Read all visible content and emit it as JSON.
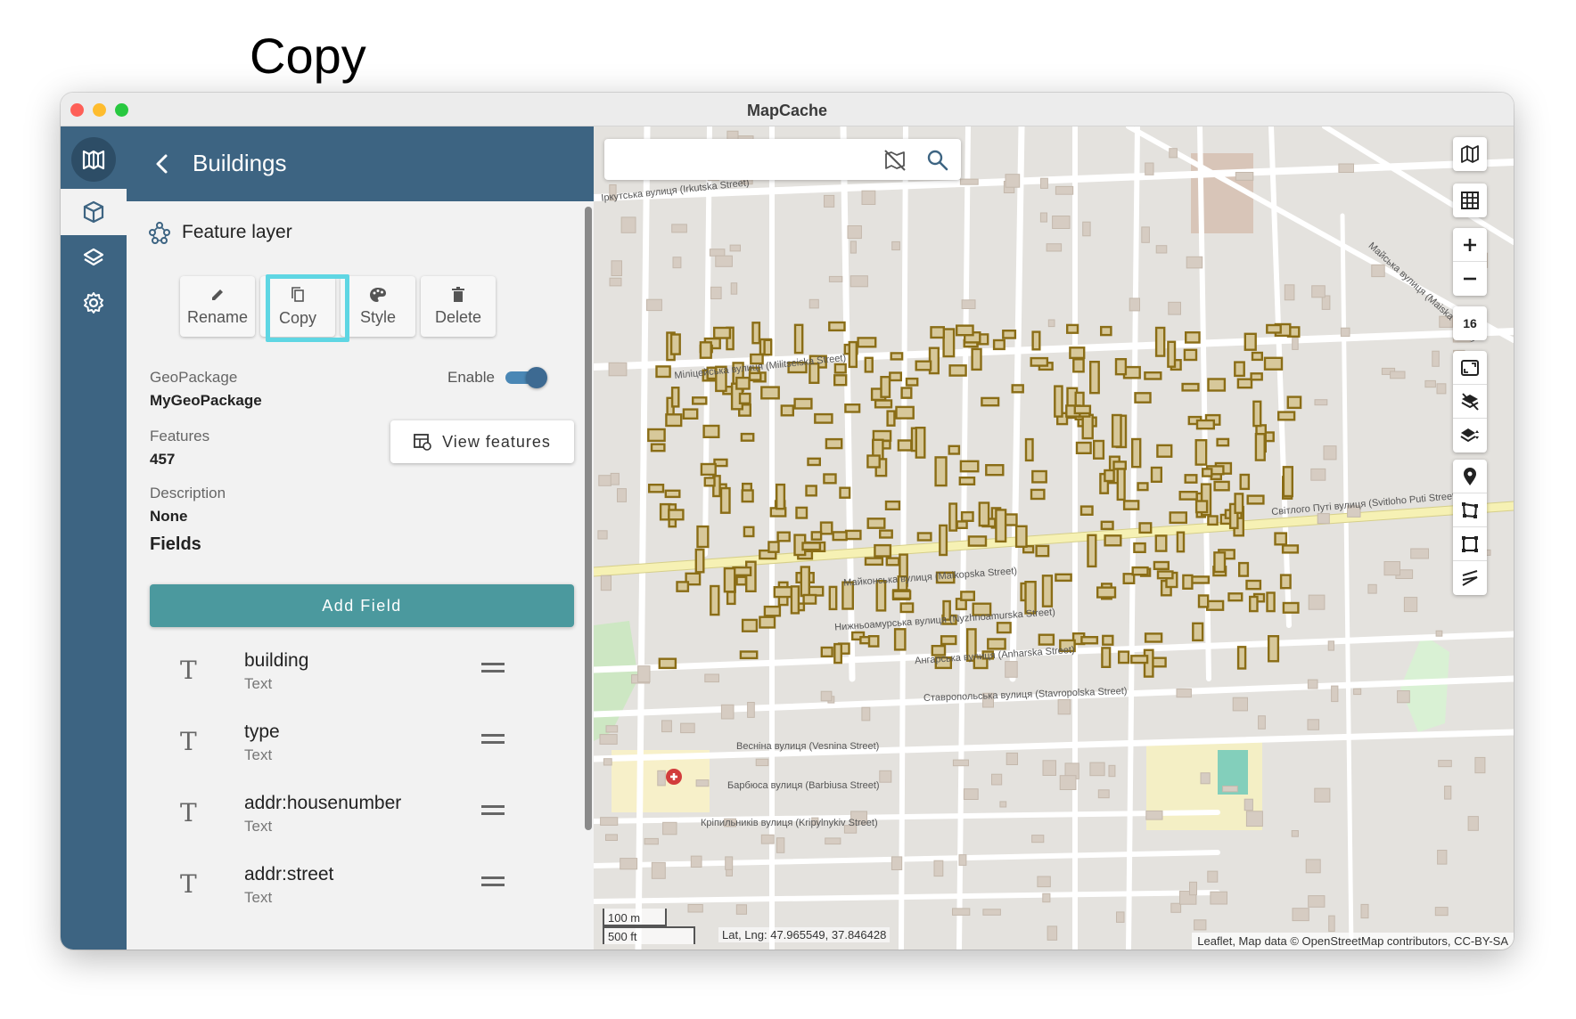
{
  "annotation": {
    "label": "Copy"
  },
  "window": {
    "title": "MapCache"
  },
  "header": {
    "title": "Buildings"
  },
  "layer": {
    "type_label": "Feature layer"
  },
  "actions": [
    {
      "label": "Rename",
      "icon": "pencil-icon"
    },
    {
      "label": "Copy",
      "icon": "copy-icon"
    },
    {
      "label": "Style",
      "icon": "palette-icon"
    },
    {
      "label": "Delete",
      "icon": "trash-icon"
    }
  ],
  "details": {
    "geopackage_label": "GeoPackage",
    "geopackage_value": "MyGeoPackage",
    "enable_label": "Enable",
    "enabled": true,
    "features_label": "Features",
    "features_value": "457",
    "description_label": "Description",
    "description_value": "None",
    "view_features_label": "View features"
  },
  "fields": {
    "title": "Fields",
    "add_label": "Add Field",
    "items": [
      {
        "name": "building",
        "type": "Text"
      },
      {
        "name": "type",
        "type": "Text"
      },
      {
        "name": "addr:housenumber",
        "type": "Text"
      },
      {
        "name": "addr:street",
        "type": "Text"
      }
    ]
  },
  "map": {
    "search_placeholder": "",
    "zoom_level": "16",
    "scale_metric": "100 m",
    "scale_imperial": "500 ft",
    "latlng": "Lat, Lng: 47.965549, 37.846428",
    "attribution": "Leaflet, Map data © OpenStreetMap contributors, CC-BY-SA",
    "streets": [
      "Іркутська вулиця (Irkutska Street)",
      "Міліцейська вулиця (Militseiska Street)",
      "Світлого Путі вулиця (Svitloho Puti Street)",
      "Майконська вулиця (Maikopska Street)",
      "Нижньоамурська вулиця (Nyzhnoamurska Street)",
      "Ангарська вулиця (Anharska Street)",
      "Ставропольська вулиця (Stavropolska Street)",
      "Весніна вулиця (Vesnina Street)",
      "Барбюса вулиця (Barbiusa Street)",
      "Кріпильників вулиця (Kripylnykiv Street)",
      "Майська вулиця (Maiska Street)"
    ],
    "building_color": "#8a6d16",
    "building_fill": "#d7c89a"
  },
  "colors": {
    "accent": "#3d6482",
    "button": "#4b999e",
    "highlight": "#5fd6e3"
  }
}
